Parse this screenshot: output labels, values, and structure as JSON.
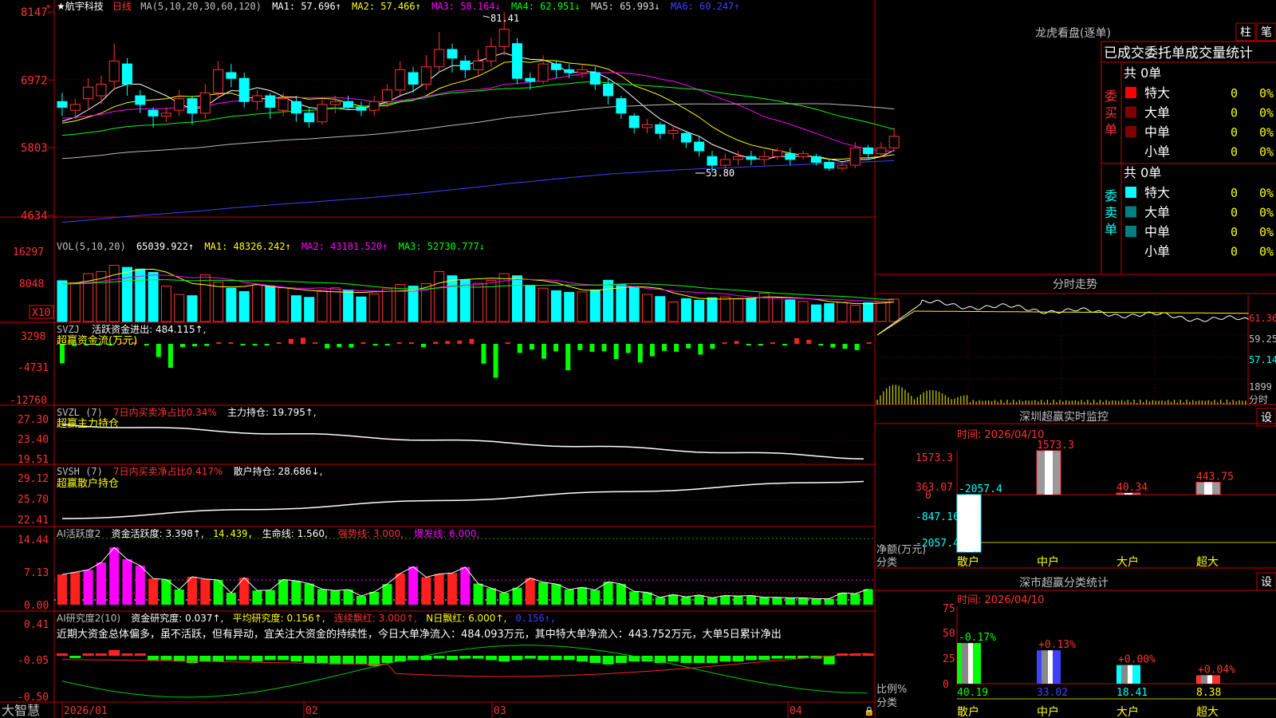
{
  "colors": {
    "up": "#ff3232",
    "down": "#00ffff",
    "white": "#ffffff",
    "yellow": "#ffff00",
    "magenta": "#ff00ff",
    "green": "#00ff00",
    "blue": "#4040ff",
    "gray": "#bbbbbb",
    "grid": "#880000",
    "axis": "#c00000",
    "text": "#c0c0c0"
  },
  "header": {
    "stock_name": "★航宇科技",
    "period": "日线",
    "ma_title": "MA(5,10,20,30,60,120)",
    "ma1": "MA1: 57.696↑",
    "ma2": "MA2: 57.466↑",
    "ma3": "MA3: 58.164↓",
    "ma4": "MA4: 62.951↓",
    "ma5": "MA5: 65.993↓",
    "ma6": "MA6: 60.247↑"
  },
  "panels": {
    "price": {
      "yticks": [
        "8147",
        "6972",
        "5803",
        "4634"
      ],
      "high_label": "81.41",
      "low_label": "53.80"
    },
    "vol": {
      "title": "VOL(5,10,20)",
      "value": "65039.922↑",
      "ma1": "MA1: 48326.242↑",
      "ma2": "MA2: 43181.520↑",
      "ma3": "MA3: 52730.777↓",
      "yticks": [
        "16297",
        "8048"
      ],
      "unit": "X10"
    },
    "svzj": {
      "title": "SVZJ",
      "line1": "活跃资金进出: 484.115↑,",
      "line2": "超赢资金流(万元)",
      "yticks": [
        "3298",
        "-4731",
        "-12760"
      ]
    },
    "svzl": {
      "title": "SVZL (7)",
      "ratio": "7日内买卖净占比0.34%",
      "hold": "主力持仓: 19.795↑,",
      "sub": "超赢主力持仓",
      "yticks": [
        "27.30",
        "23.40",
        "19.51"
      ]
    },
    "svsh": {
      "title": "SVSH (7)",
      "ratio": "7日内买卖净占比0.417%",
      "hold": "散户持仓: 28.686↓,",
      "sub": "超赢散户持仓",
      "yticks": [
        "29.12",
        "25.70",
        "22.41"
      ]
    },
    "ai": {
      "title": "AI活跃度2",
      "a": "资金活跃度: 3.398↑,",
      "b": "14.439,",
      "c": "生命线: 1.560,",
      "d": "强势线: 3.000,",
      "e": "爆发线: 6.000,",
      "yticks": [
        "14.44",
        "7.13",
        "0.00"
      ]
    },
    "research": {
      "title": "AI研究度2(10)",
      "a": "资金研究度: 0.037↑,",
      "b": "平均研究度: 0.156↑,",
      "c": "连续飘红: 3.000↑,",
      "d": "N日飘红: 6.000↑,",
      "e": "0.156↑,",
      "desc": "近期大资金总体偏多，虽不活跃，但有异动，宜关注大资金的持续性，今日大单净流入：484.093万元，其中特大单净流入：443.752万元，大单5日累计净出",
      "yticks": [
        "0.41",
        "-0.05",
        "-0.50"
      ]
    }
  },
  "xaxis": {
    "labels": [
      "2026/01",
      "02",
      "03",
      "04"
    ],
    "brand": "大智慧"
  },
  "right": {
    "longhu": {
      "title": "龙虎看盘(逐单)",
      "btn1": "柱",
      "btn2": "笔",
      "tabs": "已成交委托单成交量统计",
      "buy_label": "委买单",
      "sell_label": "委卖单",
      "buy_total": "共 0单",
      "sell_total": "共 0单",
      "rows": [
        {
          "name": "特大",
          "val": "0",
          "pct": "0%"
        },
        {
          "name": "大单",
          "val": "0",
          "pct": "0%"
        },
        {
          "name": "中单",
          "val": "0",
          "pct": "0%"
        },
        {
          "name": "小单",
          "val": "0",
          "pct": "0%"
        }
      ],
      "buy_colors": [
        "#ff0000",
        "#800000",
        "#800000",
        ""
      ],
      "sell_colors": [
        "#00ffff",
        "#008080",
        "#008080",
        ""
      ]
    },
    "fenshi": {
      "title": "分时走势",
      "yticks": [
        "61.36",
        "59.25",
        "57.14"
      ],
      "vol_max": "1899",
      "vol_unit": "分时"
    },
    "monitor": {
      "title": "深圳超赢实时监控",
      "set": "设",
      "time": "时间: 2026/04/10",
      "yticks": [
        "1573.3",
        "363.07",
        "0",
        "-847.16",
        "-2057.4"
      ],
      "ylabel": "净额(万元)",
      "xlabel": "分类",
      "cats": [
        "散户",
        "中户",
        "大户",
        "超大"
      ],
      "values": [
        -2057.4,
        1573.3,
        40.34,
        443.75
      ],
      "labels": [
        "-2057.4",
        "1573.3",
        "40.34",
        "443.75"
      ]
    },
    "classify": {
      "title": "深市超赢分类统计",
      "set": "设",
      "time": "时间: 2026/04/10",
      "yticks": [
        "75",
        "50",
        "25",
        "0"
      ],
      "ylabel": "比例%",
      "xlabel": "分类",
      "cats": [
        "散户",
        "中户",
        "大户",
        "超大"
      ],
      "values": [
        40.19,
        33.02,
        18.41,
        8.38
      ],
      "labels": [
        "40.19",
        "33.02",
        "18.41",
        "8.38"
      ],
      "changes": [
        "-0.17%",
        "+0.13%",
        "+0.00%",
        "+0.04%"
      ]
    }
  },
  "chart_data": [
    {
      "type": "candlestick",
      "title": "航宇科技 日线",
      "ylim": [
        46.34,
        81.47
      ],
      "candles": [
        [
          66,
          65,
          67.5,
          63.5
        ],
        [
          64.5,
          65.5,
          66.5,
          63
        ],
        [
          66.5,
          68.5,
          70,
          64.5
        ],
        [
          67,
          69,
          70.5,
          65.5
        ],
        [
          69.5,
          73,
          76,
          68
        ],
        [
          72.5,
          69,
          73.5,
          67
        ],
        [
          67,
          65.5,
          68,
          64
        ],
        [
          64.5,
          63.5,
          65,
          61.5
        ],
        [
          63.5,
          64,
          65,
          62.5
        ],
        [
          64.5,
          66.5,
          68,
          63.5
        ],
        [
          66.5,
          64,
          67,
          62
        ],
        [
          64,
          67.5,
          69,
          63
        ],
        [
          67.5,
          71.5,
          73,
          66.5
        ],
        [
          71,
          70,
          72.5,
          68.5
        ],
        [
          70,
          66,
          71,
          65
        ],
        [
          66,
          67,
          68,
          64.5
        ],
        [
          67,
          65,
          67.5,
          63
        ],
        [
          64.5,
          66.5,
          67.5,
          63.5
        ],
        [
          66,
          64,
          67,
          62.5
        ],
        [
          64,
          62.5,
          65,
          61.5
        ],
        [
          62.5,
          65.5,
          66.5,
          62
        ],
        [
          65.5,
          66,
          67,
          64
        ],
        [
          66,
          65,
          67,
          64.5
        ],
        [
          65,
          64.5,
          66,
          63.5
        ],
        [
          64.5,
          66,
          67,
          63.5
        ],
        [
          66,
          68,
          69,
          65
        ],
        [
          68,
          71.5,
          73,
          67
        ],
        [
          71,
          69,
          72,
          67.5
        ],
        [
          69,
          72,
          74,
          68
        ],
        [
          72,
          75,
          78,
          71
        ],
        [
          75,
          73.5,
          76,
          71
        ],
        [
          73,
          71.5,
          74,
          70
        ],
        [
          71.5,
          73,
          75,
          70.5
        ],
        [
          73,
          75.5,
          77,
          72
        ],
        [
          75.5,
          78.5,
          81.41,
          74
        ],
        [
          76,
          70,
          77,
          69
        ],
        [
          70,
          69.5,
          71,
          68
        ],
        [
          69.5,
          72.5,
          74,
          69
        ],
        [
          72.5,
          71.5,
          73,
          70
        ],
        [
          71.5,
          71,
          72.5,
          70
        ],
        [
          71,
          71.5,
          72.5,
          70
        ],
        [
          71,
          69,
          72,
          68
        ],
        [
          69,
          67,
          70,
          65.5
        ],
        [
          66.5,
          64,
          67,
          63
        ],
        [
          63.5,
          61.5,
          64,
          60.5
        ],
        [
          61.5,
          62,
          63,
          60.5
        ],
        [
          62,
          60.5,
          62.5,
          59.5
        ],
        [
          60.5,
          61,
          62,
          59.5
        ],
        [
          60.5,
          59,
          61,
          58
        ],
        [
          59,
          57.5,
          60,
          56.5
        ],
        [
          56.5,
          55,
          57.5,
          53.8
        ],
        [
          55,
          56,
          57,
          54.5
        ],
        [
          56,
          56.5,
          57.5,
          55
        ],
        [
          56.5,
          56,
          57.5,
          55
        ],
        [
          56,
          56.5,
          57.5,
          55
        ],
        [
          56.5,
          57.5,
          58,
          56
        ],
        [
          57,
          56,
          58,
          55
        ],
        [
          56.5,
          57,
          57.5,
          56
        ],
        [
          56.5,
          55.5,
          57,
          55
        ],
        [
          55.5,
          54.5,
          56,
          54
        ],
        [
          54.5,
          55,
          55.5,
          54
        ],
        [
          55,
          58,
          59,
          54.5
        ],
        [
          58,
          57,
          58.5,
          56
        ],
        [
          57,
          58,
          59,
          56.5
        ],
        [
          58,
          60,
          61.5,
          57.5
        ]
      ],
      "series": [
        {
          "name": "MA1",
          "values": "5-day"
        },
        {
          "name": "MA2",
          "values": "10-day"
        },
        {
          "name": "MA3",
          "values": "20-day"
        },
        {
          "name": "MA4",
          "values": "30-day"
        },
        {
          "name": "MA5",
          "values": "60-day"
        },
        {
          "name": "MA6",
          "values": "120-day"
        }
      ]
    },
    {
      "type": "bar",
      "title": "VOL(5,10,20)",
      "ylim": [
        0,
        16297
      ],
      "unit": "X10",
      "values": [
        9800,
        9300,
        11500,
        12000,
        13500,
        13000,
        12600,
        11800,
        8500,
        6500,
        6200,
        11200,
        9500,
        8000,
        7200,
        8800,
        8600,
        8100,
        6200,
        5800,
        7500,
        8100,
        7600,
        5900,
        6600,
        7800,
        8900,
        8500,
        9100,
        12000,
        11000,
        10000,
        9200,
        9900,
        11500,
        11000,
        8700,
        8000,
        7400,
        7000,
        7100,
        7600,
        9900,
        8900,
        8400,
        6500,
        6000,
        4700,
        5500,
        5100,
        5700,
        5900,
        5400,
        5600,
        6800,
        5800,
        5200,
        4800,
        4000,
        4300,
        4600,
        3900,
        4500,
        4800,
        5400,
        5700
      ]
    },
    {
      "type": "bar",
      "title": "SVZJ 超赢资金流(万元)",
      "ylim": [
        -12760,
        3298
      ],
      "values": [
        -4731,
        -500,
        -300,
        -200,
        -300,
        0,
        0,
        -400,
        -3200,
        -5800,
        -800,
        -600,
        -500,
        0,
        0,
        -300,
        -200,
        -200,
        0,
        1200,
        1500,
        0,
        -1100,
        -800,
        -900,
        0,
        -400,
        -300,
        0,
        0,
        -800,
        500,
        700,
        800,
        1200,
        -4800,
        -8200,
        0,
        -2200,
        -1400,
        -3600,
        -1800,
        -6400,
        -1500,
        -1900,
        -1800,
        -3700,
        -2200,
        -4500,
        -3000,
        -1700,
        -1900,
        -1100,
        -2600,
        -1200,
        0,
        700,
        -200,
        -400,
        0,
        -300,
        1400,
        1000,
        -200,
        -900,
        -1200,
        -1500,
        300,
        -300,
        0
      ]
    },
    {
      "type": "line",
      "title": "SVZL 超赢主力持仓",
      "ylim": [
        19.51,
        27.3
      ]
    },
    {
      "type": "line",
      "title": "SVSH 超赢散户持仓",
      "ylim": [
        22.41,
        29.12
      ]
    },
    {
      "type": "bar",
      "title": "AI活跃度2",
      "ylim": [
        0,
        14.44
      ],
      "values": [
        6.6,
        7.1,
        7.6,
        9.2,
        12.5,
        9.9,
        8.5,
        5.7,
        5.5,
        3.3,
        6.1,
        5.6,
        5.4,
        2.6,
        5.9,
        3.1,
        3.2,
        5.5,
        5.2,
        4.6,
        3.4,
        3.1,
        3.3,
        1.9,
        2.8,
        4.5,
        6.8,
        8.3,
        6.0,
        6.7,
        6.9,
        8.2,
        4.6,
        3.6,
        2.6,
        3.7,
        5.8,
        4.9,
        4.5,
        3.3,
        3.8,
        3.2,
        5.0,
        4.5,
        2.9,
        2.7,
        1.6,
        2.2,
        1.7,
        2.1,
        1.5,
        2.0,
        1.9,
        2.0,
        1.6,
        1.6,
        1.5,
        1.5,
        1.3,
        1.3,
        2.6,
        2.4,
        3.4
      ]
    },
    {
      "type": "bar",
      "title": "AI研究度2(10)",
      "ylim": [
        -0.5,
        0.41
      ]
    }
  ]
}
